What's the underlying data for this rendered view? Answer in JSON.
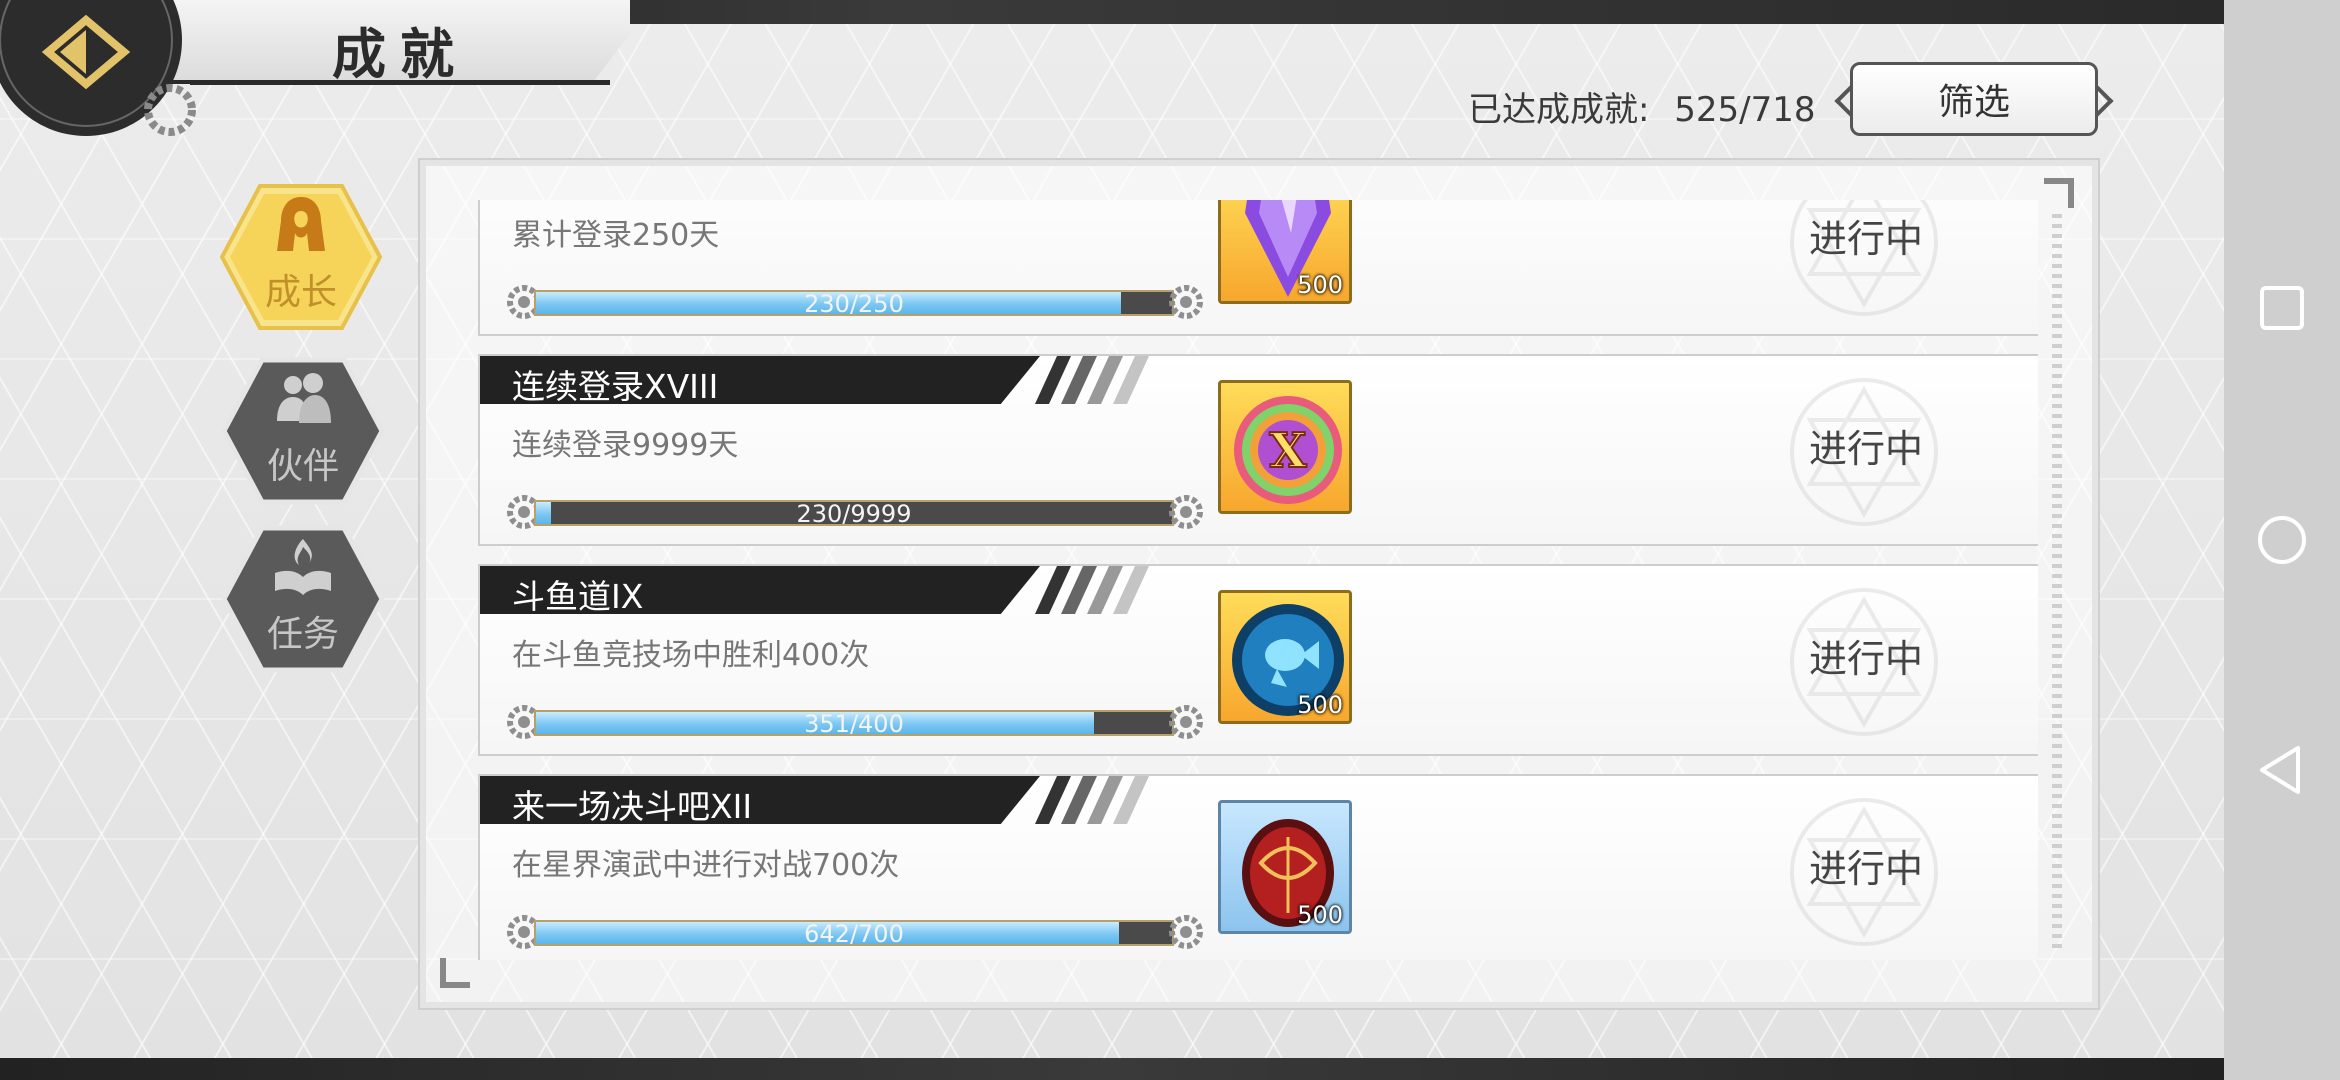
{
  "header": {
    "title": "成就",
    "progress_label": "已达成成就:",
    "progress_value": "525/718",
    "filter_label": "筛选"
  },
  "tabs": [
    {
      "label": "成长",
      "icon": "hooded-figure-icon",
      "active": true
    },
    {
      "label": "伙伴",
      "icon": "companions-icon",
      "active": false
    },
    {
      "label": "任务",
      "icon": "book-flame-icon",
      "active": false
    }
  ],
  "achievements": [
    {
      "title": "",
      "description": "累计登录250天",
      "progress_text": "230/250",
      "progress_fraction": 0.92,
      "reward_icon": "purple-crystal-icon",
      "reward_count": "500",
      "status": "进行中"
    },
    {
      "title": "连续登录XVIII",
      "description": "连续登录9999天",
      "progress_text": "230/9999",
      "progress_fraction": 0.023,
      "reward_icon": "rainbow-x-medal-icon",
      "reward_count": "",
      "status": "进行中"
    },
    {
      "title": "斗鱼道IX",
      "description": "在斗鱼竞技场中胜利400次",
      "progress_text": "351/400",
      "progress_fraction": 0.8775,
      "reward_icon": "blue-fish-orb-icon",
      "reward_count": "500",
      "status": "进行中"
    },
    {
      "title": "来一场决斗吧XII",
      "description": "在星界演武中进行对战700次",
      "progress_text": "642/700",
      "progress_fraction": 0.917,
      "reward_icon": "red-egg-icon",
      "reward_count": "500",
      "status": "进行中"
    }
  ],
  "colors": {
    "accent_gold": "#f6cf4a",
    "progress_blue": "#7cc7f2",
    "title_bar": "#222222"
  }
}
